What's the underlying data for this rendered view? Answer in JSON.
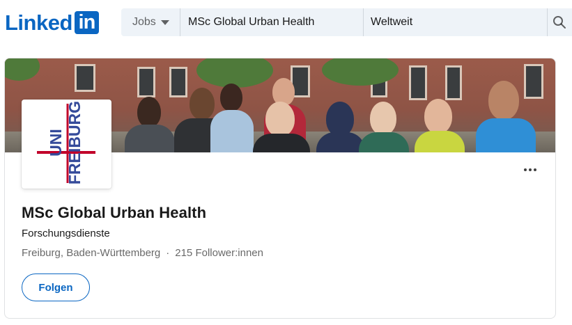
{
  "header": {
    "logo_text": "Linked",
    "logo_box_text": "in",
    "search": {
      "category_label": "Jobs",
      "keyword_value": "MSc Global Urban Health",
      "location_value": "Weltweit"
    }
  },
  "company": {
    "logo_text": "UNI FREIBURG",
    "name": "MSc Global Urban Health",
    "industry": "Forschungsdienste",
    "location": "Freiburg, Baden-Württemberg",
    "separator": "·",
    "followers": "215 Follower:innen",
    "follow_label": "Folgen"
  },
  "colors": {
    "brand": "#0a66c2",
    "search_bg": "#eef3f8",
    "uni_blue": "#344a9a",
    "uni_red": "#c1002a"
  }
}
